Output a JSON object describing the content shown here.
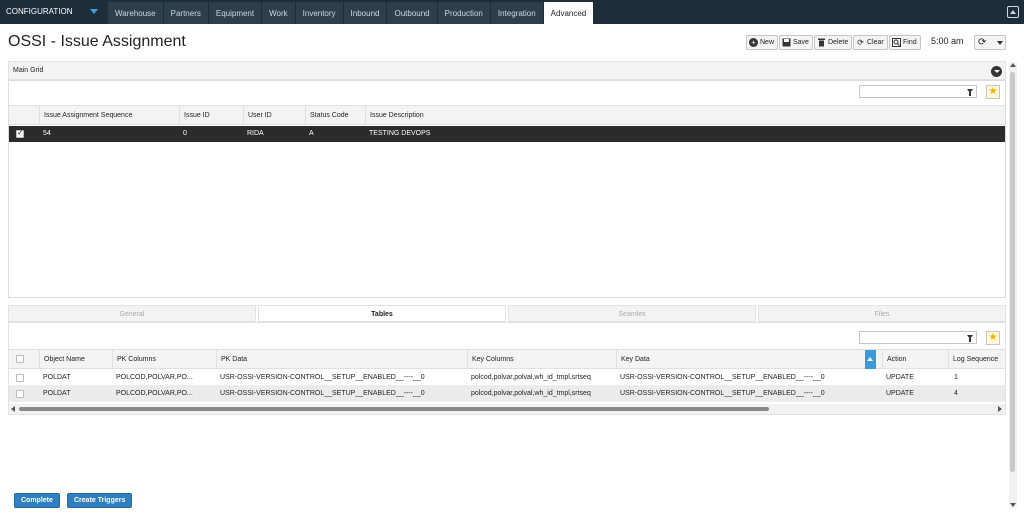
{
  "topbar": {
    "module": "CONFIGURATION",
    "tabs": [
      {
        "label": "Warehouse"
      },
      {
        "label": "Partners"
      },
      {
        "label": "Equipment"
      },
      {
        "label": "Work"
      },
      {
        "label": "Inventory"
      },
      {
        "label": "Inbound"
      },
      {
        "label": "Outbound"
      },
      {
        "label": "Production"
      },
      {
        "label": "Integration"
      },
      {
        "label": "Advanced",
        "active": true
      }
    ]
  },
  "page": {
    "title": "OSSI - Issue Assignment"
  },
  "toolbar": {
    "new_label": "New",
    "save_label": "Save",
    "delete_label": "Delete",
    "clear_label": "Clear",
    "find_label": "Find",
    "time": "5:00 am"
  },
  "main_grid": {
    "title": "Main Grid",
    "columns": [
      "Issue Assignment Sequence",
      "Issue ID",
      "User ID",
      "Status Code",
      "Issue Description"
    ],
    "rows": [
      {
        "selected": true,
        "cells": [
          "54",
          "0",
          "RIDA",
          "A",
          "TESTING DEVOPS"
        ]
      }
    ]
  },
  "sub_tabs": [
    {
      "label": "General"
    },
    {
      "label": "Tables",
      "active": true
    },
    {
      "label": "Seamles"
    },
    {
      "label": "Files"
    }
  ],
  "tables_grid": {
    "columns": [
      "Object Name",
      "PK Columns",
      "PK Data",
      "Key Columns",
      "Key Data",
      "Action",
      "Log Sequence"
    ],
    "rows": [
      {
        "cells": [
          "POLDAT",
          "POLCOD,POLVAR,PO...",
          "USR-OSSI-VERSION-CONTROL__SETUP__ENABLED__----__0",
          "polcod,polvar,polval,wh_id_tmpl,srtseq",
          "USR-OSSI-VERSION-CONTROL__SETUP__ENABLED__----__0",
          "UPDATE",
          "1"
        ]
      },
      {
        "cells": [
          "POLDAT",
          "POLCOD,POLVAR,PO...",
          "USR-OSSI-VERSION-CONTROL__SETUP__ENABLED__----__0",
          "polcod,polvar,polval,wh_id_tmpl,srtseq",
          "USR-OSSI-VERSION-CONTROL__SETUP__ENABLED__----__0",
          "UPDATE",
          "4"
        ]
      }
    ]
  },
  "actions": {
    "complete_label": "Complete",
    "create_triggers_label": "Create Triggers"
  },
  "colors": {
    "topbar": "#1e2d3a",
    "accent": "#2f7fc1",
    "selected_row": "#2b2b2b"
  }
}
